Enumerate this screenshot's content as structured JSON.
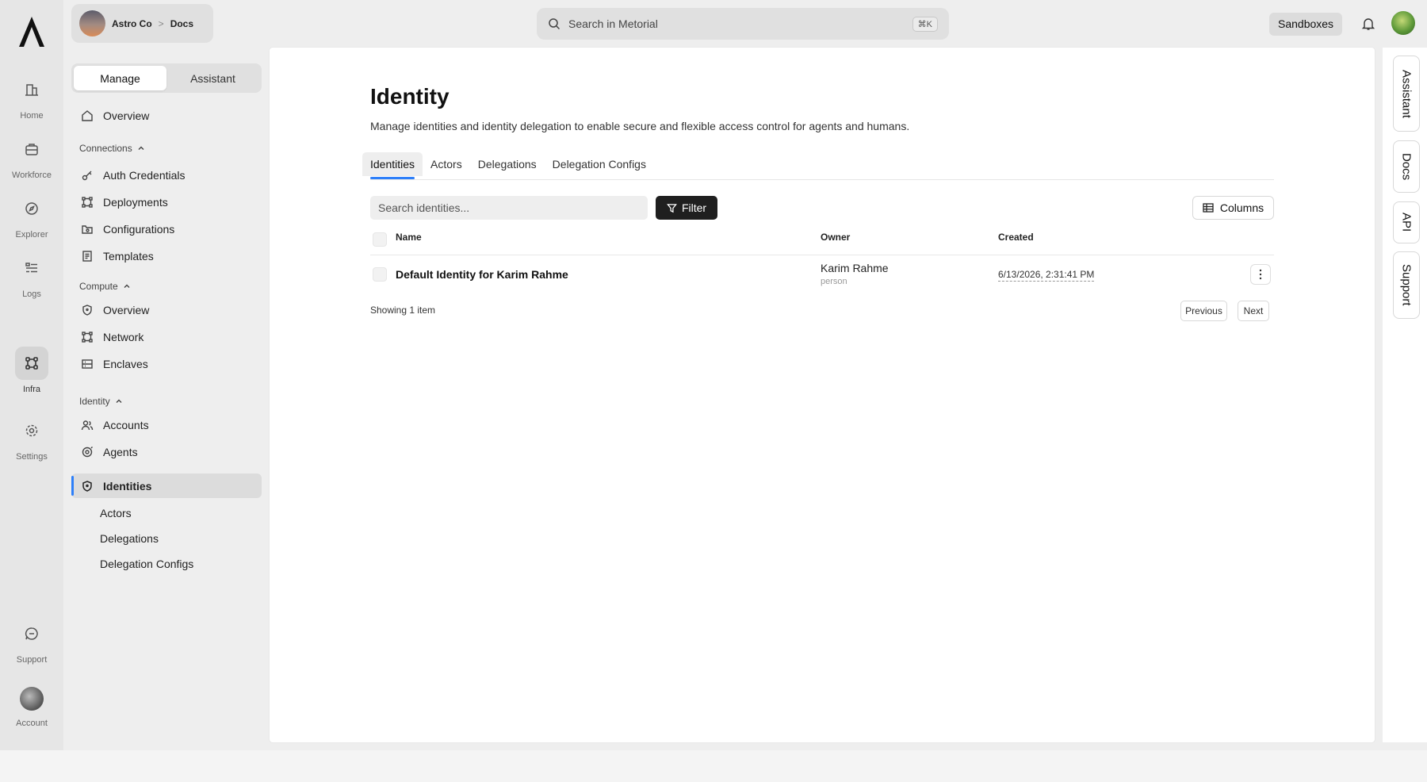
{
  "workspace": {
    "name": "Astro Co",
    "separator": ">",
    "section": "Docs"
  },
  "search": {
    "placeholder": "Search in Metorial",
    "shortcut": "⌘K"
  },
  "topbar": {
    "sandboxes_label": "Sandboxes"
  },
  "rail": {
    "items": [
      {
        "label": "Home",
        "icon": "building-icon"
      },
      {
        "label": "Workforce",
        "icon": "briefcase-icon"
      },
      {
        "label": "Explorer",
        "icon": "compass-icon"
      },
      {
        "label": "Logs",
        "icon": "list-icon"
      },
      {
        "label": "Infra",
        "icon": "network-icon",
        "active": true
      },
      {
        "label": "Settings",
        "icon": "gear-icon"
      },
      {
        "label": "Support",
        "icon": "chat-icon"
      },
      {
        "label": "Account",
        "icon": "avatar"
      }
    ]
  },
  "sidebar": {
    "toggle": {
      "manage": "Manage",
      "assistant": "Assistant"
    },
    "overview": "Overview",
    "connections": {
      "title": "Connections",
      "items": [
        "Auth Credentials",
        "Deployments",
        "Configurations",
        "Templates"
      ]
    },
    "compute": {
      "title": "Compute",
      "items": [
        "Overview",
        "Network",
        "Enclaves"
      ]
    },
    "identity": {
      "title": "Identity",
      "items": [
        "Accounts",
        "Agents",
        "Identities"
      ],
      "sub": [
        "Actors",
        "Delegations",
        "Delegation Configs"
      ]
    }
  },
  "main": {
    "title": "Identity",
    "description": "Manage identities and identity delegation to enable secure and flexible access control for agents and humans.",
    "tabs": [
      "Identities",
      "Actors",
      "Delegations",
      "Delegation Configs"
    ],
    "search_placeholder": "Search identities...",
    "filter_label": "Filter",
    "columns_label": "Columns",
    "table": {
      "headers": {
        "name": "Name",
        "owner": "Owner",
        "created": "Created"
      },
      "rows": [
        {
          "name": "Default Identity for Karim Rahme",
          "owner": "Karim Rahme",
          "owner_type": "person",
          "created": "6/13/2026, 2:31:41 PM"
        }
      ]
    },
    "showing": "Showing 1 item",
    "pagination": {
      "previous": "Previous",
      "next": "Next"
    }
  },
  "right_tabs": [
    "Assistant",
    "Docs",
    "API",
    "Support"
  ]
}
